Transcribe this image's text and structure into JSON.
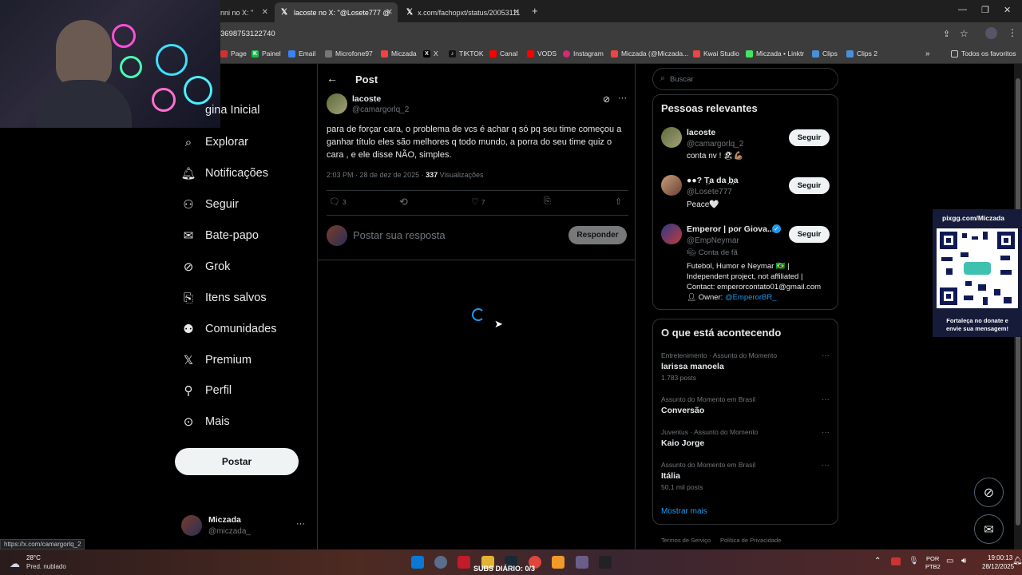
{
  "browser": {
    "tabs": [
      {
        "title": "nni no X: \""
      },
      {
        "title": "lacoste no X: \"@Losete777 @"
      },
      {
        "title": "x.com/fachopxt/status/20053111"
      }
    ],
    "url": "3698753122740",
    "bookmarks": [
      "Page",
      "Painel",
      "Email",
      "Microfone97",
      "Miczada",
      "X",
      "TIKTOK",
      "Canal",
      "VODS",
      "Instagram",
      "Miczada (@Miczada...",
      "Kwai Studio",
      "Miczada • Linktr",
      "Clips",
      "Clips 2"
    ],
    "favorites_label": "Todos os favoritos",
    "status_url": "https://x.com/camargorlq_2"
  },
  "nav": {
    "items": [
      {
        "label": "gina Inicial",
        "icon": "home-icon"
      },
      {
        "label": "Explorar",
        "icon": "search-icon"
      },
      {
        "label": "Notificações",
        "icon": "bell-icon"
      },
      {
        "label": "Seguir",
        "icon": "person-plus-icon"
      },
      {
        "label": "Bate-papo",
        "icon": "mail-icon"
      },
      {
        "label": "Grok",
        "icon": "grok-icon"
      },
      {
        "label": "Itens salvos",
        "icon": "bookmark-icon"
      },
      {
        "label": "Comunidades",
        "icon": "people-icon"
      },
      {
        "label": "Premium",
        "icon": "x-logo-icon"
      },
      {
        "label": "Perfil",
        "icon": "person-icon"
      },
      {
        "label": "Mais",
        "icon": "more-circle-icon"
      }
    ],
    "post_button": "Postar",
    "account": {
      "name": "Miczada",
      "handle": "@miczada_"
    }
  },
  "post": {
    "header": "Post",
    "author_name": "lacoste",
    "author_handle": "@camargorlq_2",
    "text": "para de forçar cara, o problema de vcs é achar q só pq seu time começou a ganhar título eles são melhores q todo mundo, a porra do seu time quiz o cara , e ele disse NÃO, simples.",
    "time": "2:03 PM · 28 de dez de 2025 · ",
    "views": "337",
    "views_label": " Visualizações",
    "reply_count": "3",
    "like_count": "7",
    "reply_placeholder": "Postar sua resposta",
    "reply_button": "Responder"
  },
  "sidebar": {
    "search_placeholder": "Buscar",
    "relevant_title": "Pessoas relevantes",
    "people": [
      {
        "name": "lacoste",
        "handle": "@camargorlq_2",
        "bio": "conta nv ! 🏖💪🏽",
        "follow": "Seguir"
      },
      {
        "name": "●●? T᷊᷊a da ᷊b᷊᷊a",
        "handle": "@Losete777",
        "bio": "Peace🤍",
        "follow": "Seguir"
      },
      {
        "name": "Emperor | por Giova...",
        "handle": "@EmpNeymar",
        "tag": "Conta de fã",
        "bio1": "Futebol, Humor e Neymar 🇧🇷 |",
        "bio2": "Independent project, not affiliated |",
        "bio3": "Contact: emperorcontato01@gmail.com",
        "owner_label": "Owner:",
        "owner_link": "@EmperorBR_",
        "follow": "Seguir"
      }
    ],
    "trends_title": "O que está acontecendo",
    "trends": [
      {
        "meta": "Entretenimento · Assunto do Momento",
        "name": "larissa manoela",
        "count": "1.783 posts"
      },
      {
        "meta": "Assunto do Momento em Brasil",
        "name": "Conversão",
        "count": ""
      },
      {
        "meta": "Juventus · Assunto do Momento",
        "name": "Kaio Jorge",
        "count": ""
      },
      {
        "meta": "Assunto do Momento em Brasil",
        "name": "Itália",
        "count": "50,1 mil posts"
      }
    ],
    "show_more": "Mostrar mais",
    "footer1": "Termos de Serviço",
    "footer2": "Política de Privacidade"
  },
  "overlay": {
    "pix_title": "pixgg.com/Miczada",
    "pix_caption1": "Fortaleça no donate e",
    "pix_caption2": "envie sua mensagem!"
  },
  "taskbar": {
    "temp": "28°C",
    "weather": "Pred. nublado",
    "subs": "SUBS DIÁRIO: 0/3",
    "lang1": "POR",
    "lang2": "PTB2",
    "time": "19:00:13",
    "date": "28/12/2025"
  }
}
